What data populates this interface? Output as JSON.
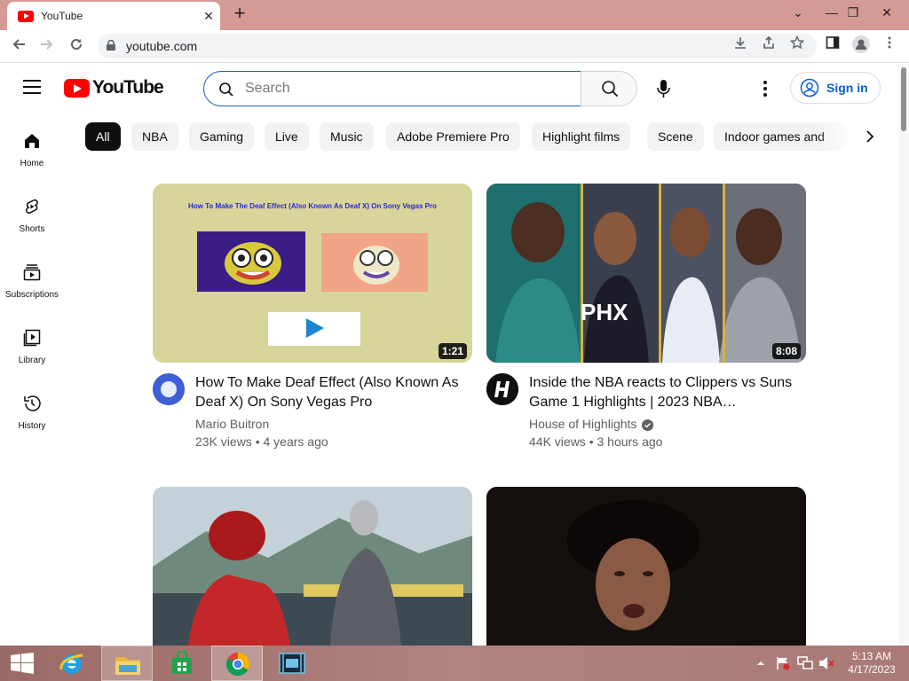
{
  "browser": {
    "tab_title": "YouTube",
    "tab_close": "✕",
    "new_tab": "+",
    "url": "youtube.com",
    "window_controls": {
      "minimize": "⌄",
      "restore": "—",
      "maximize": "❐",
      "close": "✕"
    },
    "icons": [
      "back-icon",
      "forward-icon",
      "reload-icon",
      "lock-icon",
      "download-icon",
      "share-icon",
      "star-icon",
      "side-panel-icon",
      "profile-icon",
      "kebab-menu-icon"
    ]
  },
  "youtube": {
    "logo_text": "YouTube",
    "search_placeholder": "Search",
    "signin_label": "Sign in",
    "sidebar": [
      {
        "label": "Home",
        "icon": "home-icon"
      },
      {
        "label": "Shorts",
        "icon": "shorts-icon"
      },
      {
        "label": "Subscriptions",
        "icon": "subscriptions-icon"
      },
      {
        "label": "Library",
        "icon": "library-icon"
      },
      {
        "label": "History",
        "icon": "history-icon"
      }
    ],
    "chips": [
      "All",
      "NBA",
      "Gaming",
      "Live",
      "Music",
      "Adobe Premiere Pro",
      "Highlight films",
      "Scene",
      "Indoor games and"
    ],
    "videos": [
      {
        "thumb_title": "How To Make The Deaf Effect (Also Known As Deaf X) On Sony Vegas Pro",
        "duration": "1:21",
        "title": "How To Make Deaf Effect (Also Known As Deaf X) On Sony Vegas Pro",
        "channel": "Mario Buitron",
        "meta": "23K views • 4 years ago"
      },
      {
        "duration": "8:08",
        "title": "Inside the NBA reacts to Clippers vs Suns Game 1 Highlights | 2023 NBA…",
        "channel": "House of Highlights",
        "verified": true,
        "meta": "44K views • 3 hours ago",
        "jersey_text": "PHX"
      }
    ]
  },
  "taskbar": {
    "time": "5:13 AM",
    "date": "4/17/2023",
    "apps": [
      "windows-start-icon",
      "internet-explorer-icon",
      "file-explorer-icon",
      "store-icon",
      "chrome-icon",
      "video-editor-icon"
    ]
  }
}
